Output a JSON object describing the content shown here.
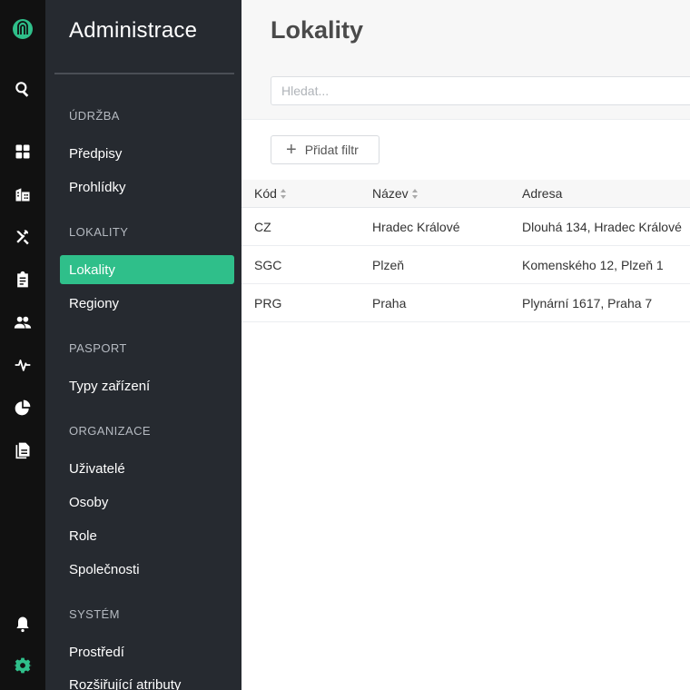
{
  "rail": {
    "icons": [
      "logo-icon",
      "search-icon",
      "dashboard-icon",
      "buildings-icon",
      "tools-icon",
      "clipboard-icon",
      "users-icon",
      "activity-icon",
      "pie-chart-icon",
      "document-icon",
      "bell-icon",
      "gear-icon"
    ]
  },
  "colors": {
    "accent": "#2fbf8a",
    "rail_bg": "#111111",
    "sidebar_bg": "#262a30"
  },
  "sidebar": {
    "title": "Administrace",
    "sections": [
      {
        "label": "ÚDRŽBA",
        "items": [
          "Předpisy",
          "Prohlídky"
        ]
      },
      {
        "label": "LOKALITY",
        "items": [
          "Lokality",
          "Regiony"
        ]
      },
      {
        "label": "PASPORT",
        "items": [
          "Typy zařízení"
        ]
      },
      {
        "label": "ORGANIZACE",
        "items": [
          "Uživatelé",
          "Osoby",
          "Role",
          "Společnosti"
        ]
      },
      {
        "label": "SYSTÉM",
        "items": [
          "Prostředí",
          "Rozšiřující atributy"
        ]
      }
    ],
    "active_item": "Lokality"
  },
  "main": {
    "title": "Lokality",
    "search_placeholder": "Hledat...",
    "add_filter_label": "Přidat filtr",
    "columns": [
      "Kód",
      "Název",
      "Adresa"
    ],
    "rows": [
      [
        "CZ",
        "Hradec Králové",
        "Dlouhá 134, Hradec Králové"
      ],
      [
        "SGC",
        "Plzeň",
        "Komenského 12, Plzeň 1"
      ],
      [
        "PRG",
        "Praha",
        "Plynární 1617, Praha 7"
      ]
    ]
  }
}
